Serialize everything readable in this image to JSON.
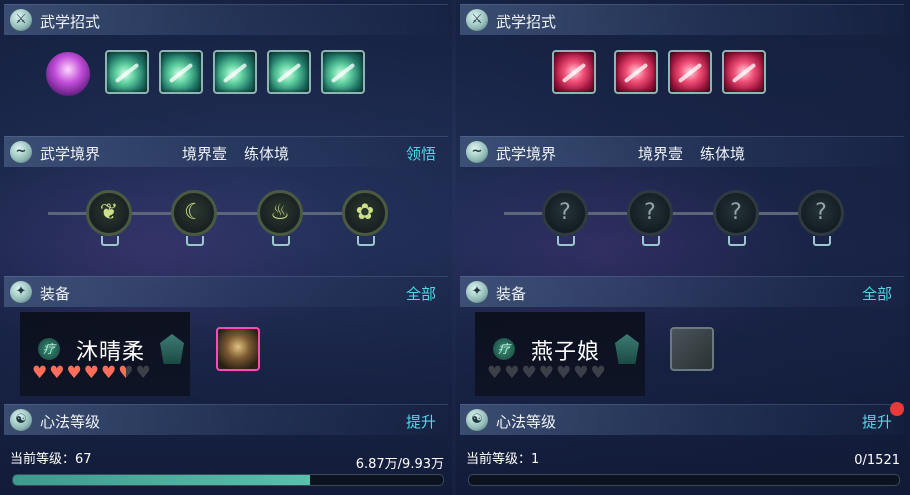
{
  "left": {
    "sections": {
      "skills_title": "武学招式",
      "realm_title": "武学境界",
      "realm_stage": "境界壹",
      "realm_name": "练体境",
      "realm_action": "领悟",
      "equip_title": "装备",
      "equip_action": "全部",
      "heart_title": "心法等级",
      "heart_action": "提升"
    },
    "skill_icons": [
      "green-skill-1",
      "green-skill-2",
      "green-skill-3",
      "green-skill-4",
      "green-skill-5"
    ],
    "realm_nodes": [
      {
        "state": "unlocked",
        "glyph": "❦"
      },
      {
        "state": "unlocked",
        "glyph": "☾"
      },
      {
        "state": "unlocked",
        "glyph": "♨"
      },
      {
        "state": "unlocked",
        "glyph": "✿"
      }
    ],
    "character": {
      "badge": "疗",
      "name": "沐晴柔",
      "hearts_full": 5,
      "hearts_half": 1,
      "hearts_total": 7
    },
    "equipment_slot": "armor-item",
    "level_label": "当前等级：67",
    "exp_text": "6.87万/9.93万",
    "exp_fraction": 0.69
  },
  "right": {
    "sections": {
      "skills_title": "武学招式",
      "realm_title": "武学境界",
      "realm_stage": "境界壹",
      "realm_name": "练体境",
      "equip_title": "装备",
      "equip_action": "全部",
      "heart_title": "心法等级",
      "heart_action": "提升"
    },
    "skill_icons": [
      "red-skill-1",
      "red-skill-2",
      "red-skill-3",
      "red-skill-4"
    ],
    "realm_nodes": [
      {
        "state": "locked",
        "glyph": "?"
      },
      {
        "state": "locked",
        "glyph": "?"
      },
      {
        "state": "locked",
        "glyph": "?"
      },
      {
        "state": "locked",
        "glyph": "?"
      }
    ],
    "character": {
      "badge": "疗",
      "name": "燕子娘",
      "hearts_full": 0,
      "hearts_half": 0,
      "hearts_total": 7
    },
    "equipment_slot": "empty-slot",
    "level_label": "当前等级：1",
    "exp_text": "0/1521",
    "exp_fraction": 0,
    "has_notification": true
  }
}
